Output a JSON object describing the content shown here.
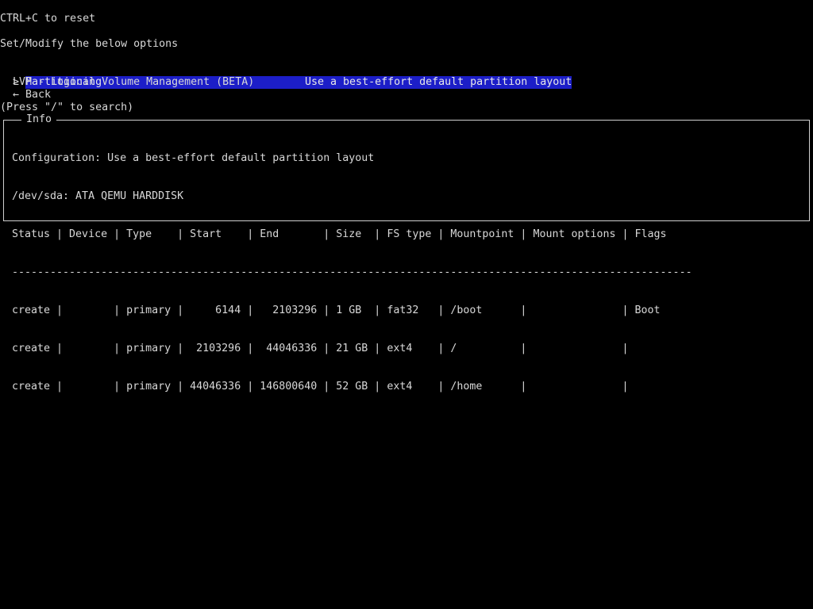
{
  "header": {
    "reset_hint": "CTRL+C to reset",
    "instructions": "Set/Modify the below options"
  },
  "menu": {
    "cursor": ">",
    "selected": {
      "label": "Partitioning",
      "value": "Use a best-effort default partition layout"
    },
    "items": [
      {
        "label": "LVM - Logical Volume Management (BETA)"
      },
      {
        "label": "← Back"
      }
    ],
    "search_hint": "(Press \"/\" to search)"
  },
  "info": {
    "title": "Info",
    "configuration": "Configuration: Use a best-effort default partition layout",
    "device": "/dev/sda: ATA QEMU HARDDISK",
    "table_header": "Status | Device | Type    | Start    | End       | Size  | FS type | Mountpoint | Mount options | Flags",
    "separator": "-----------------------------------------------------------------------------------------------------------",
    "rows": [
      "create |        | primary |     6144 |   2103296 | 1 GB  | fat32   | /boot      |               | Boot",
      "create |        | primary |  2103296 |  44046336 | 21 GB | ext4    | /          |               |",
      "create |        | primary | 44046336 | 146800640 | 52 GB | ext4    | /home      |               |"
    ]
  }
}
